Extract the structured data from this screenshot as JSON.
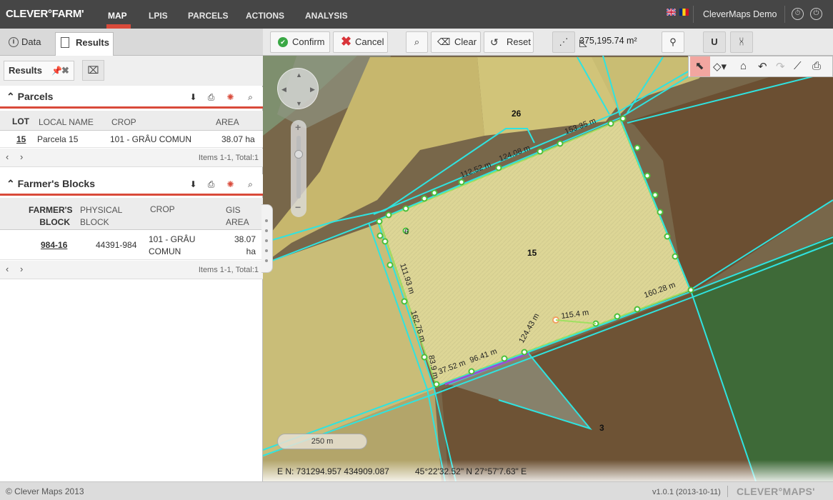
{
  "app": {
    "logo": "CLEVER°FARM'",
    "nav": [
      "MAP",
      "LPIS",
      "PARCELS",
      "ACTIONS",
      "ANALYSIS"
    ],
    "user": "CleverMaps Demo"
  },
  "left_panel": {
    "tabs": [
      "Data",
      "Results"
    ],
    "results_chip": "Results",
    "parcels": {
      "title": "Parcels",
      "columns": [
        "LOT",
        "LOCAL NAME",
        "CROP",
        "AREA"
      ],
      "rows": [
        {
          "lot": "15",
          "name": "Parcela 15",
          "crop": "101 - GRÂU COMUN",
          "area": "38.07 ha"
        }
      ],
      "pager": "Items 1-1, Total:1"
    },
    "blocks": {
      "title": "Farmer's Blocks",
      "col_farmer_1": "FARMER'S",
      "col_farmer_2": "BLOCK",
      "col_phys_1": "PHYSICAL",
      "col_phys_2": "BLOCK",
      "col_crop": "CROP",
      "col_gis_1": "GIS",
      "col_gis_2": "AREA",
      "row": {
        "block": "984-16",
        "physical": "44391-984",
        "crop_1": "101 - GRÂU",
        "crop_2": "COMUN",
        "area_1": "38.07",
        "area_2": "ha"
      },
      "pager": "Items 1-1, Total:1"
    }
  },
  "map_toolbar": {
    "confirm": "Confirm",
    "cancel": "Cancel",
    "clear": "Clear",
    "reset": "Reset",
    "area": "375,195.74 m²"
  },
  "map": {
    "parcel_labels": [
      "26",
      "15",
      "3"
    ],
    "segment_labels": [
      "153.35 m",
      "124.08 m",
      "112.52 m",
      "111.93 m",
      "162.76 m",
      "83.9 m",
      "37.52 m",
      "96.41 m",
      "124.43 m",
      "115.4 m",
      "160.28 m",
      "6"
    ],
    "scale": "250 m",
    "en_coords": "E N: 731294.957 434909.087",
    "latlon": "45°22'32.52\" N 27°57'7.63\" E"
  },
  "footer": {
    "copyright": "© Clever Maps 2013",
    "version": "v1.0.1 (2013-10-11)",
    "brand": "CLEVER°MAPS'"
  }
}
